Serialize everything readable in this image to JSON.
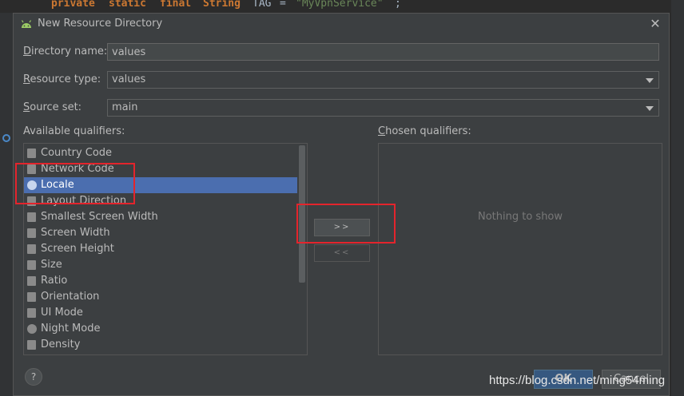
{
  "editor": {
    "code": {
      "kw1": "private",
      "kw2": "static",
      "kw3": "final",
      "type": "String",
      "ident": "TAG",
      "eq": "=",
      "str": "\"MyVpnService\"",
      "end": ";"
    }
  },
  "dialog": {
    "title": "New Resource Directory",
    "directory_name": {
      "label_hotkey": "D",
      "label_rest": "irectory name:",
      "value": "values"
    },
    "resource_type": {
      "label_hotkey": "R",
      "label_rest": "esource type:",
      "value": "values"
    },
    "source_set": {
      "label_hotkey": "S",
      "label_rest": "ource set:",
      "value": "main"
    },
    "available_label": "Available qualifiers:",
    "chosen_label_hotkey": "C",
    "chosen_label_rest": "hosen qualifiers:",
    "qualifiers": [
      {
        "label": "Country Code",
        "icon": "country-code-icon"
      },
      {
        "label": "Network Code",
        "icon": "network-code-icon"
      },
      {
        "label": "Locale",
        "icon": "globe-icon",
        "selected": true
      },
      {
        "label": "Layout Direction",
        "icon": "layout-direction-icon"
      },
      {
        "label": "Smallest Screen Width",
        "icon": "smallest-width-icon"
      },
      {
        "label": "Screen Width",
        "icon": "screen-width-icon"
      },
      {
        "label": "Screen Height",
        "icon": "screen-height-icon"
      },
      {
        "label": "Size",
        "icon": "size-icon"
      },
      {
        "label": "Ratio",
        "icon": "ratio-icon"
      },
      {
        "label": "Orientation",
        "icon": "orientation-icon"
      },
      {
        "label": "UI Mode",
        "icon": "ui-mode-icon"
      },
      {
        "label": "Night Mode",
        "icon": "night-mode-icon"
      },
      {
        "label": "Density",
        "icon": "density-icon"
      }
    ],
    "add_button": ">>",
    "remove_button": "<<",
    "chosen_empty": "Nothing to show",
    "help_button": "?",
    "ok_button": "OK",
    "cancel_button": "Cancel",
    "close_icon": "close-icon"
  },
  "colors": {
    "selection": "#4b6eaf",
    "annotation": "#e4242c",
    "dialog_bg": "#3c3f41"
  },
  "watermark": "https://blog.csdn.net/ming54ming"
}
